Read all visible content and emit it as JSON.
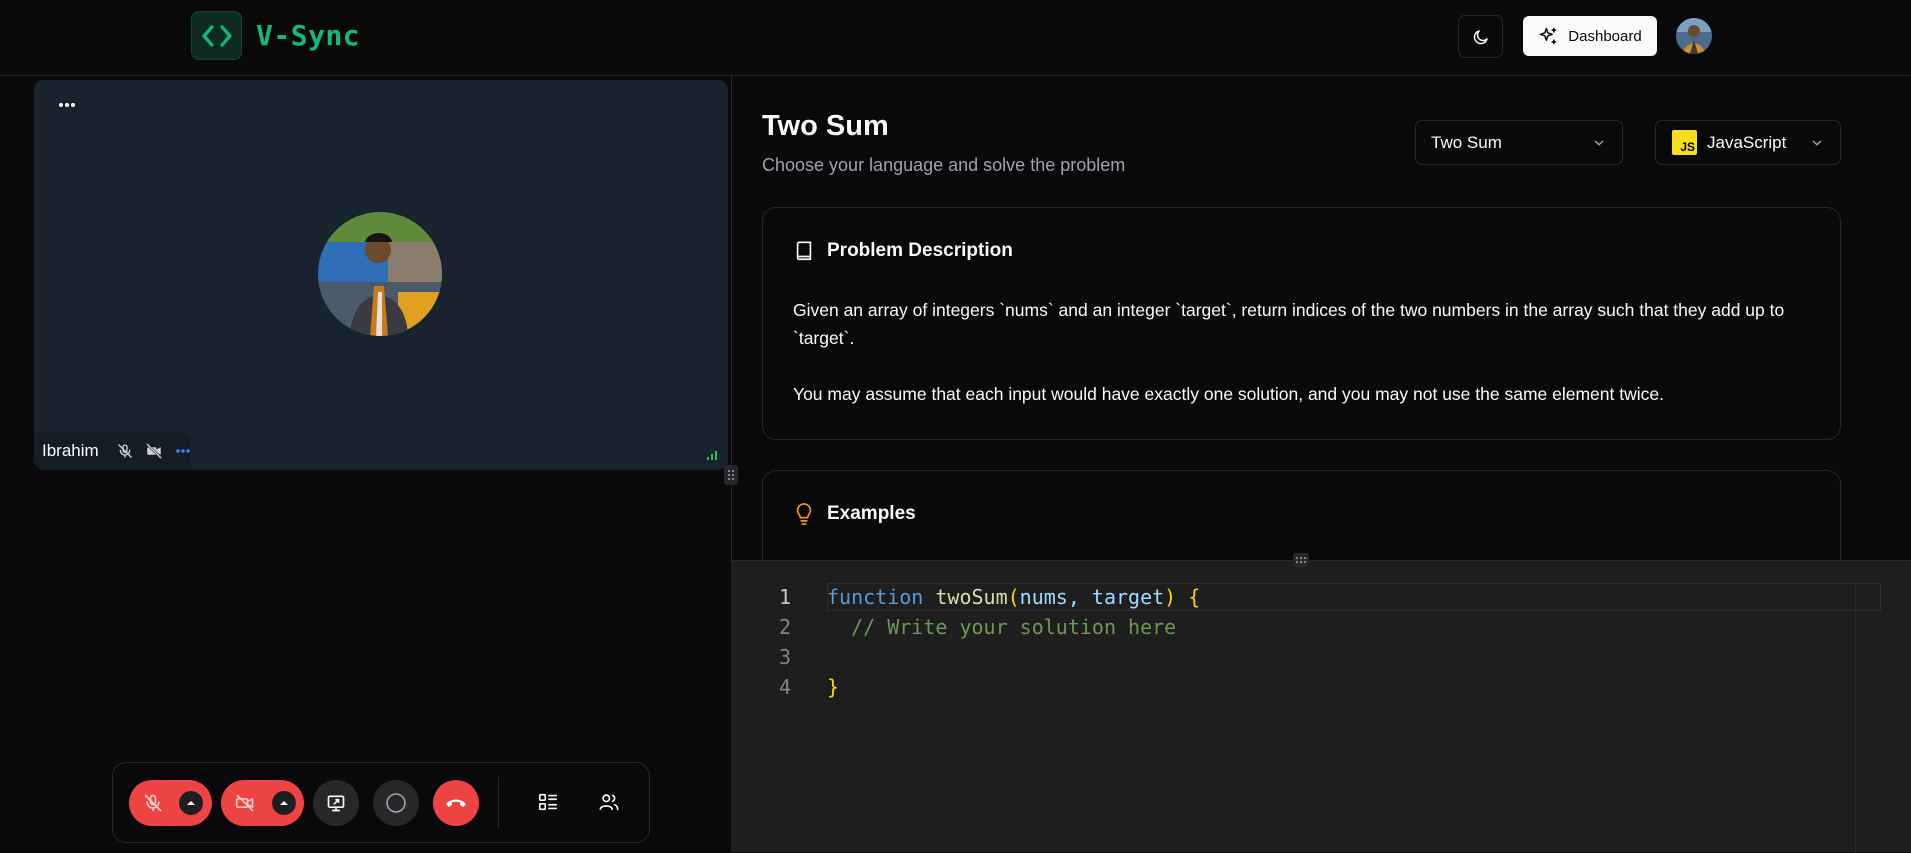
{
  "header": {
    "brand": "V-Sync",
    "dashboard_label": "Dashboard"
  },
  "call": {
    "participant_name": "Ibrahim"
  },
  "problem": {
    "title": "Two Sum",
    "subtitle": "Choose your language and solve the problem",
    "problem_select": "Two Sum",
    "language_select": "JavaScript",
    "language_badge": "JS",
    "description_heading": "Problem Description",
    "description_p1": "Given an array of integers `nums` and an integer `target`, return indices of the two numbers in the array such that they add up to `target`.",
    "description_p2": "You may assume that each input would have exactly one solution, and you may not use the same element twice.",
    "examples_heading": "Examples"
  },
  "editor": {
    "line_numbers": [
      "1",
      "2",
      "3",
      "4"
    ],
    "code": {
      "kw_function": "function",
      "fn_name": "twoSum",
      "open_paren": "(",
      "params": "nums, target",
      "close_paren": ")",
      "open_brace": "{",
      "comment": "// Write your solution here",
      "close_brace": "}"
    }
  },
  "colors": {
    "brand_accent": "#10b981",
    "danger": "#ef4444",
    "tile_bg": "#19232d",
    "editor_bg": "#1e1e1e"
  }
}
